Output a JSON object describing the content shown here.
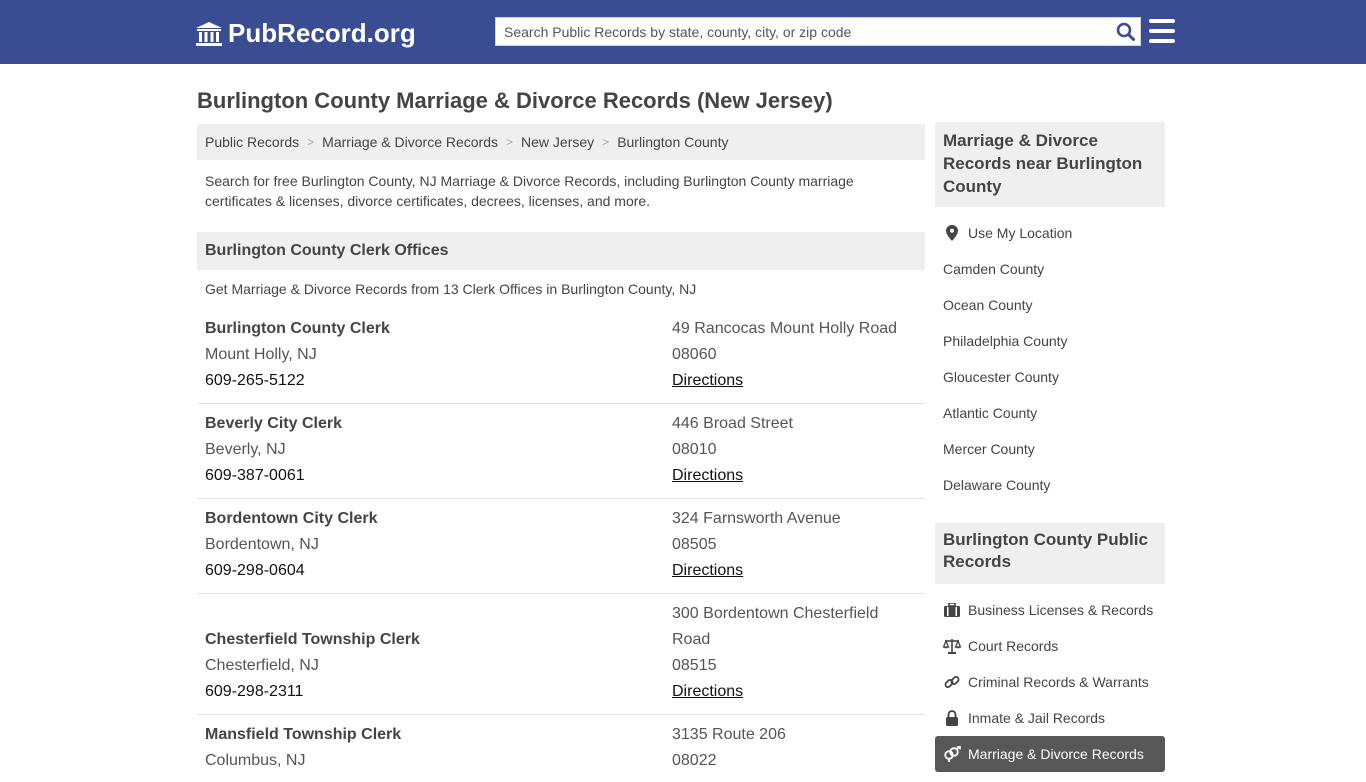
{
  "header": {
    "logo_text": "PubRecord.org",
    "search_placeholder": "Search Public Records by state, county, city, or zip code"
  },
  "page_title": "Burlington County Marriage & Divorce Records (New Jersey)",
  "breadcrumb": [
    "Public Records",
    "Marriage & Divorce Records",
    "New Jersey",
    "Burlington County"
  ],
  "intro": "Search for free Burlington County, NJ Marriage & Divorce Records, including Burlington County marriage certificates & licenses, divorce certificates, decrees, licenses, and more.",
  "section": {
    "title": "Burlington County Clerk Offices",
    "subtitle": "Get Marriage & Divorce Records from 13 Clerk Offices in Burlington County, NJ"
  },
  "offices": [
    {
      "name": "Burlington County Clerk",
      "city": "Mount Holly, NJ",
      "phone": "609-265-5122",
      "address": "49 Rancocas Mount Holly Road",
      "address2": "",
      "zip": "08060",
      "directions": "Directions"
    },
    {
      "name": "Beverly City Clerk",
      "city": "Beverly, NJ",
      "phone": "609-387-0061",
      "address": "446 Broad Street",
      "address2": "",
      "zip": "08010",
      "directions": "Directions"
    },
    {
      "name": "Bordentown City Clerk",
      "city": "Bordentown, NJ",
      "phone": "609-298-0604",
      "address": "324 Farnsworth Avenue",
      "address2": "",
      "zip": "08505",
      "directions": "Directions"
    },
    {
      "name": "Chesterfield Township Clerk",
      "city": "Chesterfield, NJ",
      "phone": "609-298-2311",
      "address": "300 Bordentown Chesterfield",
      "address2": "Road",
      "zip": "08515",
      "directions": "Directions"
    },
    {
      "name": "Mansfield Township Clerk",
      "city": "Columbus, NJ",
      "phone": "",
      "address": "3135 Route 206",
      "address2": "",
      "zip": "08022",
      "directions": ""
    }
  ],
  "sidebar": {
    "nearby_title": "Marriage & Divorce Records near Burlington County",
    "use_location": "Use My Location",
    "nearby": [
      "Camden County",
      "Ocean County",
      "Philadelphia County",
      "Gloucester County",
      "Atlantic County",
      "Mercer County",
      "Delaware County"
    ],
    "public_title": "Burlington County Public Records",
    "public": [
      {
        "label": "Business Licenses & Records",
        "icon": "briefcase-icon"
      },
      {
        "label": "Court Records",
        "icon": "scales-icon"
      },
      {
        "label": "Criminal Records & Warrants",
        "icon": "link-icon"
      },
      {
        "label": "Inmate & Jail Records",
        "icon": "lock-icon"
      }
    ],
    "active": {
      "label": "Marriage & Divorce Records",
      "icon": "gender-icon"
    }
  },
  "colors": {
    "header_bg": "#3a4c92",
    "panel_bg": "#efefef",
    "active_bg": "#575757"
  }
}
